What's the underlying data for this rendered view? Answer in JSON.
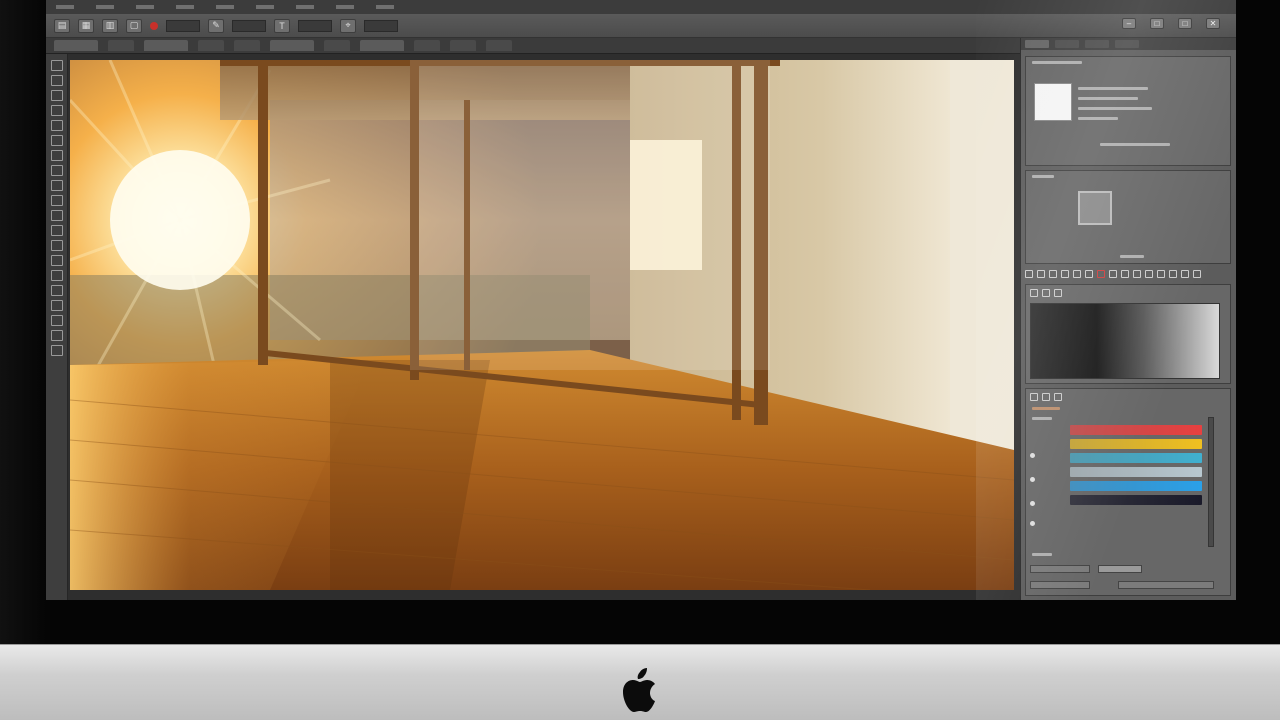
{
  "device": {
    "logo_icon": "apple-logo-icon",
    "chin_color": "#d4d4d4",
    "bezel_color": "#050505"
  },
  "menubar": {
    "items": [
      "",
      "",
      "",
      "",
      "",
      "",
      "",
      "",
      ""
    ]
  },
  "options_bar": {
    "buttons": [
      "",
      "",
      "",
      "",
      "",
      "",
      "",
      ""
    ],
    "icons": [
      "new-file-icon",
      "grid-icon",
      "layers-icon",
      "window-icon",
      "brush-icon",
      "text-icon",
      "crop-icon",
      "dropper-icon"
    ]
  },
  "window_controls": {
    "minimize_label": "–",
    "maximize_label": "□",
    "close_label": "✕"
  },
  "toolbar": {
    "tools": [
      {
        "name": "move-tool-icon",
        "glyph": ""
      },
      {
        "name": "marquee-tool-icon",
        "glyph": ""
      },
      {
        "name": "lasso-tool-icon",
        "glyph": ""
      },
      {
        "name": "magic-wand-tool-icon",
        "glyph": ""
      },
      {
        "name": "crop-tool-icon",
        "glyph": ""
      },
      {
        "name": "eyedropper-tool-icon",
        "glyph": ""
      },
      {
        "name": "healing-tool-icon",
        "glyph": ""
      },
      {
        "name": "brush-tool-icon",
        "glyph": ""
      },
      {
        "name": "clone-tool-icon",
        "glyph": ""
      },
      {
        "name": "history-brush-tool-icon",
        "glyph": ""
      },
      {
        "name": "eraser-tool-icon",
        "glyph": ""
      },
      {
        "name": "gradient-tool-icon",
        "glyph": ""
      },
      {
        "name": "blur-tool-icon",
        "glyph": ""
      },
      {
        "name": "dodge-tool-icon",
        "glyph": ""
      },
      {
        "name": "pen-tool-icon",
        "glyph": ""
      },
      {
        "name": "type-tool-icon",
        "glyph": ""
      },
      {
        "name": "path-select-tool-icon",
        "glyph": ""
      },
      {
        "name": "shape-tool-icon",
        "glyph": ""
      },
      {
        "name": "hand-tool-icon",
        "glyph": ""
      },
      {
        "name": "zoom-tool-icon",
        "glyph": ""
      }
    ]
  },
  "canvas": {
    "scene": "sunset-room-render",
    "colors": {
      "sun": "#fff6d0",
      "sky_warm": "#f2a53a",
      "floor": "#b06a20",
      "wall": "#d8c8a8"
    }
  },
  "stripe_colors": [
    "#e84040",
    "#f0c020",
    "#40b0d0",
    "#b8c8d0",
    "#2aa0e8",
    "#1a1a2a"
  ]
}
